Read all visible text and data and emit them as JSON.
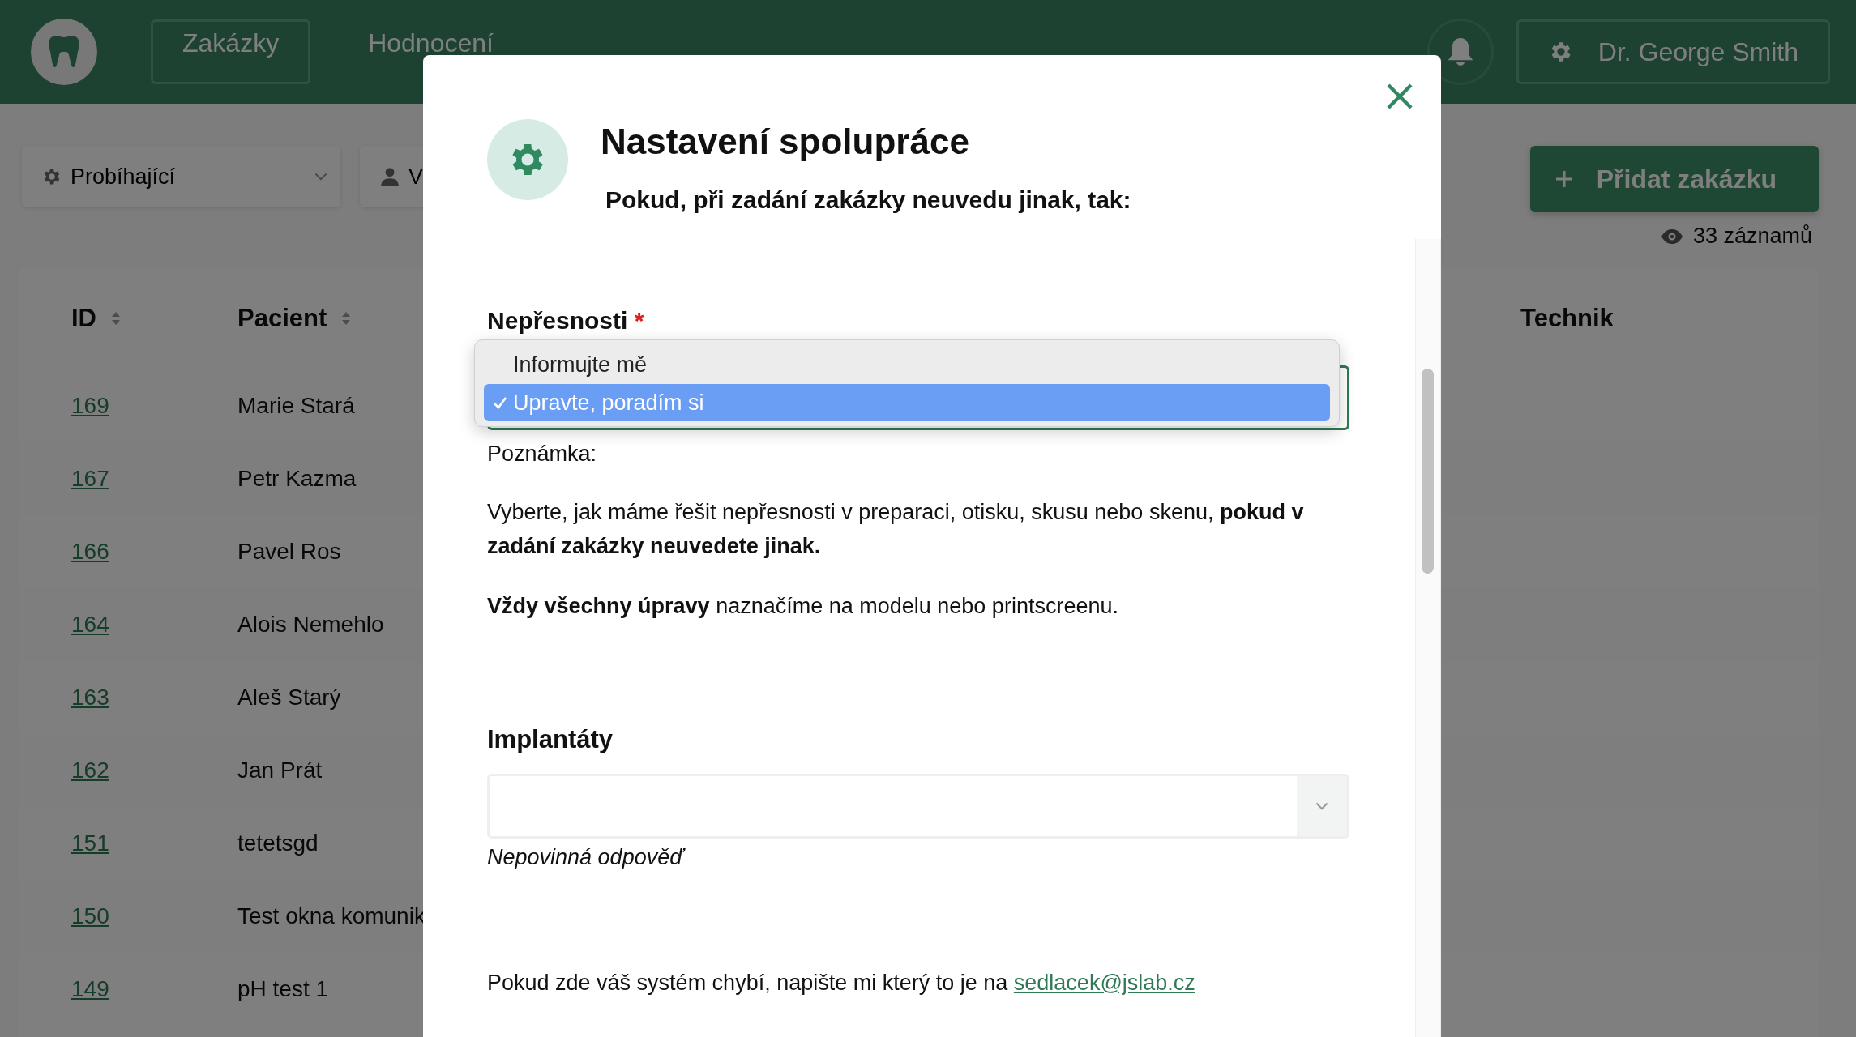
{
  "header": {
    "nav": [
      {
        "label": "Zakázky",
        "selected": true
      },
      {
        "label": "Hodnocení",
        "selected": false
      }
    ],
    "user": "Dr. George Smith"
  },
  "filters": [
    {
      "kind": "status",
      "label": "Probíhající"
    },
    {
      "kind": "person",
      "label": "V"
    }
  ],
  "add_button": "Přidat zakázku",
  "record_count": "33 záznamů",
  "table": {
    "columns": [
      {
        "label": "ID",
        "sortable": true
      },
      {
        "label": "Pacient",
        "sortable": true
      },
      {
        "label": "Technik",
        "sortable": false
      }
    ],
    "rows": [
      {
        "id": "169",
        "patient": "Marie Stará"
      },
      {
        "id": "167",
        "patient": "Petr Kazma"
      },
      {
        "id": "166",
        "patient": "Pavel Ros"
      },
      {
        "id": "164",
        "patient": "Alois Nemehlo"
      },
      {
        "id": "163",
        "patient": "Aleš Starý"
      },
      {
        "id": "162",
        "patient": "Jan Prát"
      },
      {
        "id": "151",
        "patient": "tetetsgd"
      },
      {
        "id": "150",
        "patient": "Test okna komunik"
      },
      {
        "id": "149",
        "patient": "pH test 1"
      }
    ]
  },
  "modal": {
    "title": "Nastavení spolupráce",
    "subtitle": "Pokud, při zadání zakázky neuvedu jinak, tak:",
    "inaccuracy": {
      "label": "Nepřesnosti",
      "required_mark": "*",
      "expanded": true,
      "options": [
        {
          "label": "Informujte mě",
          "selected": false
        },
        {
          "label": "Upravte, poradím si",
          "selected": true
        }
      ]
    },
    "note_label": "Poznámka:",
    "paragraphs": [
      "Vyberte, jak máme řešit nepřesnosti v preparaci, otisku, skusu nebo skenu, **pokud v zadání zakázky neuvedete jinak.**",
      "**Vždy všechny úpravy** naznačíme na modelu nebo printscreenu."
    ],
    "implants": {
      "label": "Implantáty",
      "hint": "Nepovinná odpověď"
    },
    "footer": {
      "text": "Pokud zde váš systém chybí, napište mi který to je na",
      "link": "sedlacek@jslab.cz"
    }
  }
}
